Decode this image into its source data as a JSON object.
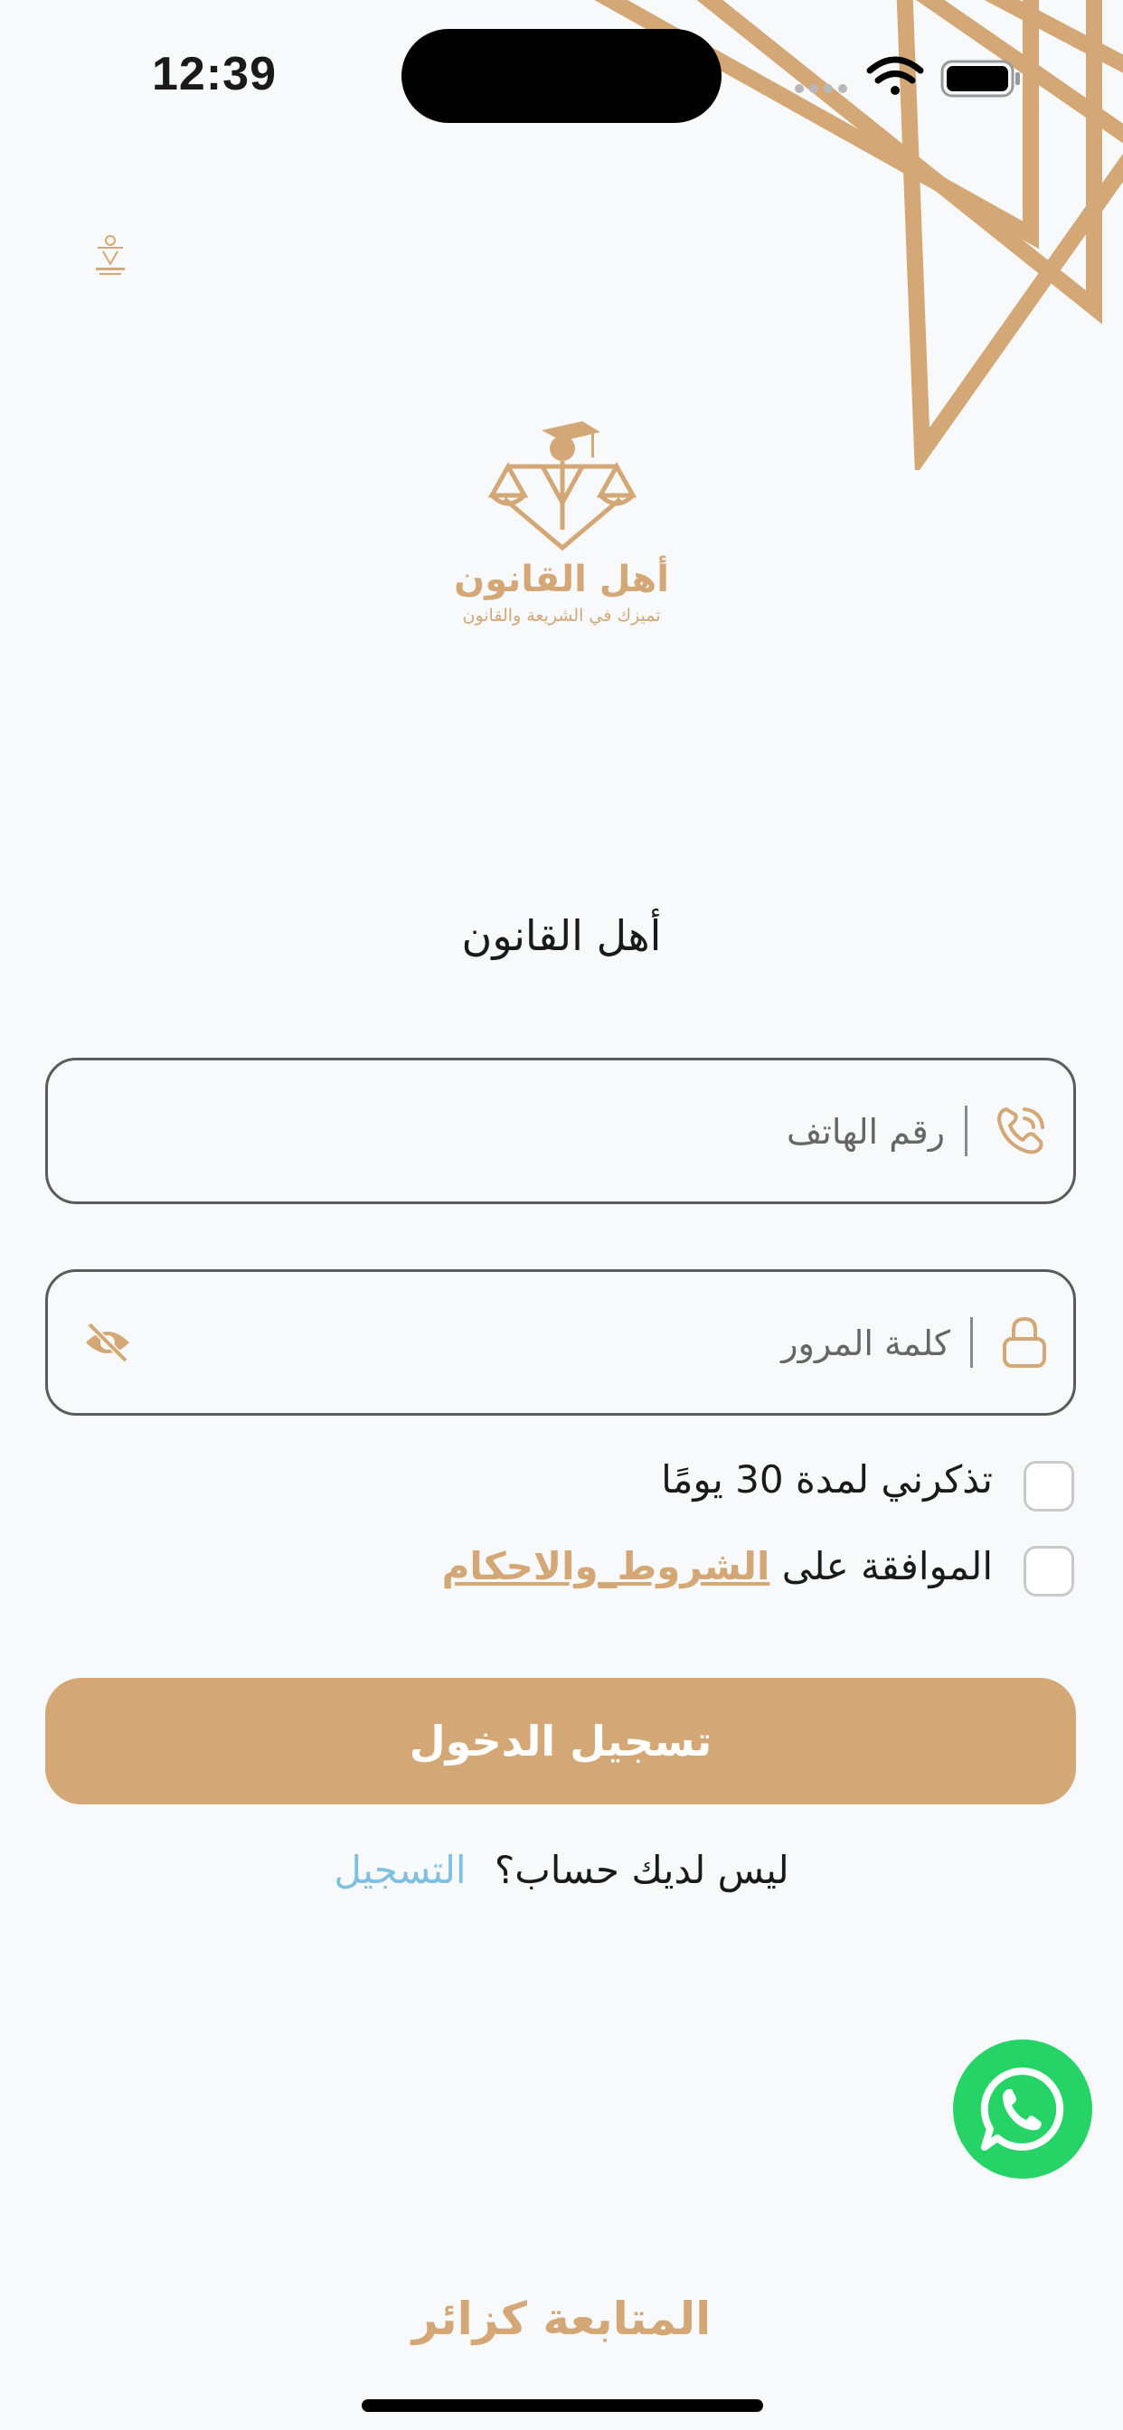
{
  "status_bar": {
    "time": "12:39"
  },
  "brand": {
    "logo_icon": "scales-graduate-logo",
    "name": "أهل القانون",
    "tagline": "تميزك في الشريعة والقانون"
  },
  "login": {
    "title": "أهل القانون",
    "phone_placeholder": "رقم الهاتف",
    "password_placeholder": "كلمة المرور",
    "remember_label": "تذكرني لمدة 30 يومًا",
    "terms_prefix": "الموافقة على",
    "terms_link": "الشروط_والاحكام",
    "login_button": "تسجيل الدخول",
    "no_account_text": "ليس لديك حساب؟",
    "signup_link": "التسجيل",
    "visitor_link": "المتابعة كزائر"
  },
  "icons": {
    "phone": "phone-icon",
    "lock": "lock-icon",
    "visibility": "eye-off-icon",
    "whatsapp": "whatsapp-icon",
    "wifi": "wifi-icon",
    "battery": "battery-icon",
    "signal": "signal-icon"
  },
  "colors": {
    "accent": "#d4a876",
    "link": "#7fbfe0",
    "whatsapp": "#25d366",
    "background": "#f7f9fb"
  }
}
